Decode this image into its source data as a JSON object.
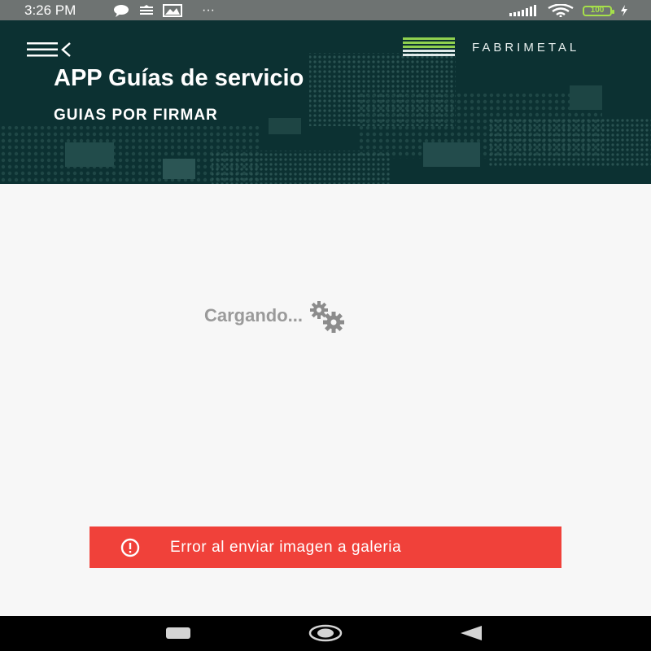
{
  "status_bar": {
    "time": "3:26 PM",
    "more": "···",
    "battery_level": "100",
    "icons": [
      "chat-icon",
      "sync-icon",
      "gallery-icon",
      "signal-icon",
      "wifi-icon",
      "battery-icon",
      "charging-icon"
    ]
  },
  "header": {
    "menu_icon": "menu-collapse-icon",
    "brand": "FABRIMETAL",
    "title": "APP Guías de servicio",
    "subtitle": "GUIAS POR FIRMAR",
    "colors": {
      "background": "#0d3233",
      "brand_accent": "#8fd14f"
    }
  },
  "main": {
    "loading_text": "Cargando...",
    "loading_icon": "gears-icon"
  },
  "toast": {
    "message": "Error al enviar imagen a galeria",
    "icon": "error-icon",
    "color": "#f0413a"
  },
  "nav_bar": {
    "buttons": [
      "recents-button",
      "home-button",
      "back-button"
    ]
  }
}
